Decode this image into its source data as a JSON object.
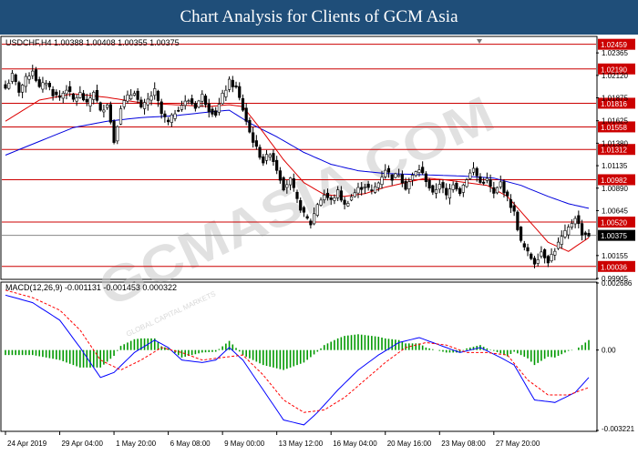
{
  "banner": {
    "title": "Chart Analysis for Clients of GCM Asia"
  },
  "watermark": {
    "text": "GCMASIA.COM",
    "subtext": "GLOBAL CAPITAL MARKETS"
  },
  "chart_data": [
    {
      "type": "candlestick",
      "title": "USDCHF,H4  1.00388 1.00408 1.00355 1.00375",
      "ylim": [
        0.99905,
        1.02535
      ],
      "y_ticks": [
        "1.02365",
        "1.02120",
        "1.01875",
        "1.01625",
        "1.01380",
        "1.01135",
        "1.00890",
        "1.00645",
        "1.00155",
        "0.99905"
      ],
      "y_tick_values": [
        1.02365,
        1.0212,
        1.01875,
        1.01625,
        1.0138,
        1.01135,
        1.0089,
        1.00645,
        1.00155,
        0.99905
      ],
      "x_ticks": [
        "24 Apr 2019",
        "29 Apr 04:00",
        "1 May 20:00",
        "6 May 08:00",
        "9 May 00:00",
        "13 May 12:00",
        "16 May 04:00",
        "20 May 16:00",
        "23 May 08:00",
        "27 May 20:00"
      ],
      "x_tick_index": [
        0,
        16,
        32,
        48,
        64,
        80,
        96,
        112,
        128,
        144
      ],
      "current_price": 1.00375,
      "current_price_label": "1.00375",
      "levels": [
        {
          "label": "1.02459",
          "value": 1.02459
        },
        {
          "label": "1.02190",
          "value": 1.0219
        },
        {
          "label": "1.01816",
          "value": 1.01816
        },
        {
          "label": "1.01558",
          "value": 1.01558
        },
        {
          "label": "1.01312",
          "value": 1.01312
        },
        {
          "label": "1.00982",
          "value": 1.00982
        },
        {
          "label": "1.00520",
          "value": 1.0052
        },
        {
          "label": "1.00036",
          "value": 1.00036
        }
      ],
      "colors": {
        "level": "#cc0000",
        "candle": "#000000",
        "ma_fast": "#dd0000",
        "ma_slow": "#0000dd",
        "current": "#888888"
      },
      "close_anchors": [
        [
          0,
          1.0198
        ],
        [
          2,
          1.0212
        ],
        [
          4,
          1.0195
        ],
        [
          6,
          1.0208
        ],
        [
          8,
          1.0218
        ],
        [
          10,
          1.0198
        ],
        [
          12,
          1.0205
        ],
        [
          14,
          1.0192
        ],
        [
          16,
          1.0188
        ],
        [
          18,
          1.0198
        ],
        [
          20,
          1.0185
        ],
        [
          22,
          1.0192
        ],
        [
          24,
          1.018
        ],
        [
          26,
          1.0195
        ],
        [
          28,
          1.0172
        ],
        [
          30,
          1.0182
        ],
        [
          32,
          1.014
        ],
        [
          34,
          1.0178
        ],
        [
          36,
          1.0188
        ],
        [
          38,
          1.0195
        ],
        [
          40,
          1.0175
        ],
        [
          42,
          1.0185
        ],
        [
          44,
          1.0195
        ],
        [
          46,
          1.017
        ],
        [
          48,
          1.016
        ],
        [
          50,
          1.0172
        ],
        [
          52,
          1.018
        ],
        [
          54,
          1.0185
        ],
        [
          56,
          1.0178
        ],
        [
          58,
          1.019
        ],
        [
          60,
          1.0175
        ],
        [
          62,
          1.017
        ],
        [
          64,
          1.019
        ],
        [
          66,
          1.0205
        ],
        [
          68,
          1.0198
        ],
        [
          70,
          1.0175
        ],
        [
          72,
          1.015
        ],
        [
          74,
          1.0132
        ],
        [
          76,
          1.0118
        ],
        [
          78,
          1.0128
        ],
        [
          80,
          1.011
        ],
        [
          82,
          1.009
        ],
        [
          84,
          1.0098
        ],
        [
          86,
          1.0075
        ],
        [
          88,
          1.006
        ],
        [
          90,
          1.005
        ],
        [
          92,
          1.0072
        ],
        [
          94,
          1.0082
        ],
        [
          96,
          1.0075
        ],
        [
          98,
          1.0085
        ],
        [
          100,
          1.007
        ],
        [
          102,
          1.008
        ],
        [
          104,
          1.0088
        ],
        [
          106,
          1.0092
        ],
        [
          108,
          1.0085
        ],
        [
          110,
          1.0095
        ],
        [
          112,
          1.011
        ],
        [
          114,
          1.01
        ],
        [
          116,
          1.0105
        ],
        [
          118,
          1.009
        ],
        [
          120,
          1.0102
        ],
        [
          122,
          1.011
        ],
        [
          124,
          1.0098
        ],
        [
          126,
          1.0082
        ],
        [
          128,
          1.0095
        ],
        [
          130,
          1.008
        ],
        [
          132,
          1.0095
        ],
        [
          134,
          1.0085
        ],
        [
          136,
          1.01
        ],
        [
          138,
          1.011
        ],
        [
          140,
          1.0095
        ],
        [
          142,
          1.0098
        ],
        [
          144,
          1.0082
        ],
        [
          146,
          1.0095
        ],
        [
          148,
          1.0078
        ],
        [
          150,
          1.0062
        ],
        [
          152,
          1.003
        ],
        [
          154,
          1.0018
        ],
        [
          156,
          1.0008
        ],
        [
          158,
          1.002
        ],
        [
          160,
          1.001
        ],
        [
          162,
          1.0022
        ],
        [
          164,
          1.0035
        ],
        [
          166,
          1.0045
        ],
        [
          168,
          1.0058
        ],
        [
          170,
          1.004
        ],
        [
          172,
          1.0038
        ]
      ],
      "ma_fast_anchors": [
        [
          0,
          1.0162
        ],
        [
          10,
          1.0185
        ],
        [
          20,
          1.0192
        ],
        [
          30,
          1.0188
        ],
        [
          40,
          1.0182
        ],
        [
          50,
          1.018
        ],
        [
          60,
          1.0178
        ],
        [
          66,
          1.018
        ],
        [
          70,
          1.0178
        ],
        [
          76,
          1.015
        ],
        [
          82,
          1.012
        ],
        [
          88,
          1.0095
        ],
        [
          94,
          1.0082
        ],
        [
          100,
          1.008
        ],
        [
          106,
          1.0083
        ],
        [
          112,
          1.009
        ],
        [
          118,
          1.0095
        ],
        [
          124,
          1.01
        ],
        [
          130,
          1.0098
        ],
        [
          136,
          1.0095
        ],
        [
          142,
          1.0092
        ],
        [
          148,
          1.008
        ],
        [
          154,
          1.0055
        ],
        [
          160,
          1.003
        ],
        [
          166,
          1.002
        ],
        [
          172,
          1.0035
        ]
      ],
      "ma_slow_anchors": [
        [
          0,
          1.0125
        ],
        [
          10,
          1.014
        ],
        [
          20,
          1.0155
        ],
        [
          30,
          1.0162
        ],
        [
          40,
          1.0166
        ],
        [
          50,
          1.0168
        ],
        [
          60,
          1.0172
        ],
        [
          66,
          1.0174
        ],
        [
          72,
          1.016
        ],
        [
          80,
          1.0145
        ],
        [
          88,
          1.0128
        ],
        [
          96,
          1.0115
        ],
        [
          104,
          1.0108
        ],
        [
          112,
          1.0105
        ],
        [
          120,
          1.0104
        ],
        [
          128,
          1.0103
        ],
        [
          136,
          1.0102
        ],
        [
          144,
          1.01
        ],
        [
          152,
          1.0092
        ],
        [
          160,
          1.008
        ],
        [
          166,
          1.0072
        ],
        [
          172,
          1.0067
        ]
      ]
    },
    {
      "type": "macd",
      "title": "MACD(12,26,9) -0.001131 -0.001453 0.000322",
      "ylim": [
        -0.003221,
        0.002686
      ],
      "y_ticks": [
        "0.002686",
        "0.00",
        "-0.003221"
      ],
      "y_tick_values": [
        0.002686,
        0.0,
        -0.003221
      ],
      "colors": {
        "histogram": "#009900",
        "macd": "#0000ff",
        "signal": "#ff0000"
      },
      "macd_anchors": [
        [
          0,
          0.0022
        ],
        [
          8,
          0.0019
        ],
        [
          16,
          0.0012
        ],
        [
          22,
          0.0001
        ],
        [
          28,
          -0.0011
        ],
        [
          32,
          -0.0009
        ],
        [
          38,
          -0.0001
        ],
        [
          44,
          0.0004
        ],
        [
          48,
          0.0001
        ],
        [
          52,
          -0.0004
        ],
        [
          58,
          -0.0005
        ],
        [
          62,
          -0.0004
        ],
        [
          66,
          0.0001
        ],
        [
          70,
          -0.0004
        ],
        [
          76,
          -0.0016
        ],
        [
          82,
          -0.0028
        ],
        [
          88,
          -0.003
        ],
        [
          92,
          -0.0025
        ],
        [
          98,
          -0.0016
        ],
        [
          104,
          -0.0008
        ],
        [
          110,
          -0.0002
        ],
        [
          116,
          0.0003
        ],
        [
          122,
          0.0005
        ],
        [
          128,
          0.0002
        ],
        [
          134,
          -0.0001
        ],
        [
          140,
          0.0001
        ],
        [
          146,
          -0.0003
        ],
        [
          150,
          -0.0006
        ],
        [
          156,
          -0.002
        ],
        [
          162,
          -0.0021
        ],
        [
          168,
          -0.0017
        ],
        [
          172,
          -0.0011
        ]
      ],
      "signal_anchors": [
        [
          0,
          0.0024
        ],
        [
          8,
          0.0021
        ],
        [
          16,
          0.0016
        ],
        [
          22,
          0.0008
        ],
        [
          28,
          -0.0004
        ],
        [
          34,
          -0.0008
        ],
        [
          40,
          -0.0004
        ],
        [
          46,
          0.0001
        ],
        [
          52,
          -0.0001
        ],
        [
          58,
          -0.0004
        ],
        [
          64,
          -0.0003
        ],
        [
          70,
          -0.0002
        ],
        [
          76,
          -0.001
        ],
        [
          82,
          -0.002
        ],
        [
          88,
          -0.0025
        ],
        [
          94,
          -0.0024
        ],
        [
          100,
          -0.0019
        ],
        [
          106,
          -0.0012
        ],
        [
          112,
          -0.0005
        ],
        [
          118,
          0.0001
        ],
        [
          124,
          0.0003
        ],
        [
          130,
          0.0002
        ],
        [
          136,
          -0.0001
        ],
        [
          142,
          -0.0001
        ],
        [
          148,
          -0.0002
        ],
        [
          154,
          -0.0012
        ],
        [
          160,
          -0.0018
        ],
        [
          166,
          -0.0018
        ],
        [
          172,
          -0.0015
        ]
      ]
    }
  ]
}
